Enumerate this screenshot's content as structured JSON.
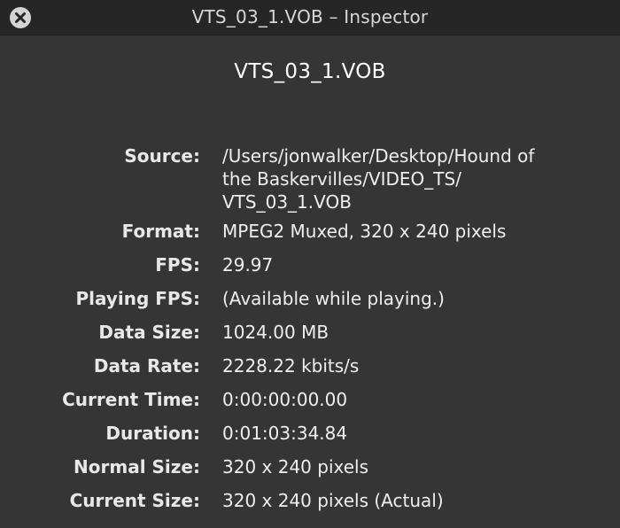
{
  "window": {
    "title": "VTS_03_1.VOB – Inspector",
    "close_icon": "close-x-icon"
  },
  "heading": "VTS_03_1.VOB",
  "rows": [
    {
      "label": "Source:",
      "value_lines": [
        "/Users/jonwalker/Desktop/Hound of",
        "the Baskervilles/VIDEO_TS/",
        "VTS_03_1.VOB"
      ]
    },
    {
      "label": "Format:",
      "value": "MPEG2 Muxed, 320 x 240 pixels"
    },
    {
      "label": "FPS:",
      "value": "29.97"
    },
    {
      "label": "Playing FPS:",
      "value": "(Available while playing.)"
    },
    {
      "label": "Data Size:",
      "value": "1024.00 MB"
    },
    {
      "label": "Data Rate:",
      "value": "2228.22 kbits/s"
    },
    {
      "label": "Current Time:",
      "value": "0:00:00:00.00"
    },
    {
      "label": "Duration:",
      "value": "0:01:03:34.84"
    },
    {
      "label": "Normal Size:",
      "value": "320 x 240 pixels"
    },
    {
      "label": "Current Size:",
      "value": "320 x 240 pixels (Actual)"
    }
  ],
  "colors": {
    "window_bg": "#353535",
    "titlebar_bg": "#262626",
    "text": "#efefef"
  }
}
